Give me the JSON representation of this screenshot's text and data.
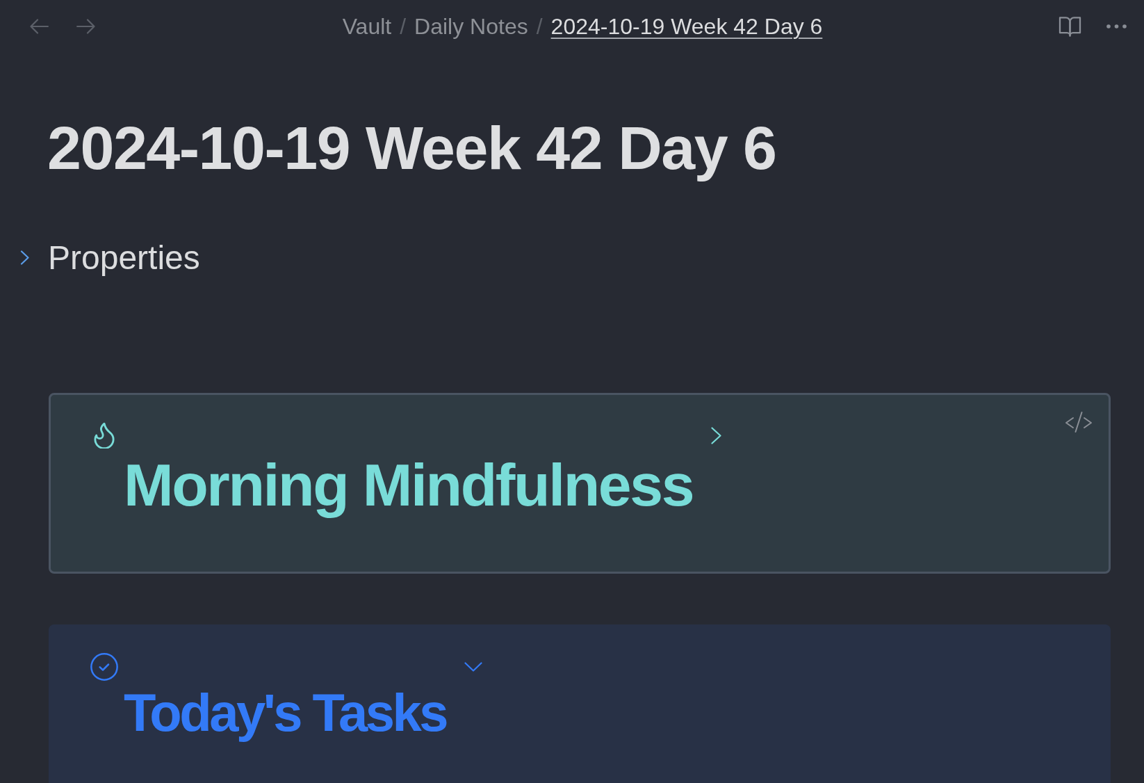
{
  "top_bar": {
    "nav_buttons": [
      {
        "kind": "back",
        "disabled": true
      },
      {
        "kind": "forward",
        "disabled": true
      }
    ],
    "breadcrumbs": [
      {
        "label": "Vault",
        "current": false,
        "separator": "/"
      },
      {
        "label": "Daily Notes",
        "current": false,
        "separator": "/"
      },
      {
        "label": "2024-10-19 Week 42 Day 6",
        "current": true
      }
    ]
  },
  "note": {
    "title": "2024-10-19 Week 42 Day 6",
    "properties": {
      "label": "Properties",
      "expanded": false
    },
    "callouts": [
      {
        "kind": "tip",
        "title": "Morning Mindfulness",
        "color": "#79dcd8",
        "expanded": false,
        "hovered": true
      },
      {
        "kind": "todo",
        "title": "Today's Tasks",
        "color": "#337af7",
        "expanded": true,
        "hovered": false
      }
    ]
  }
}
